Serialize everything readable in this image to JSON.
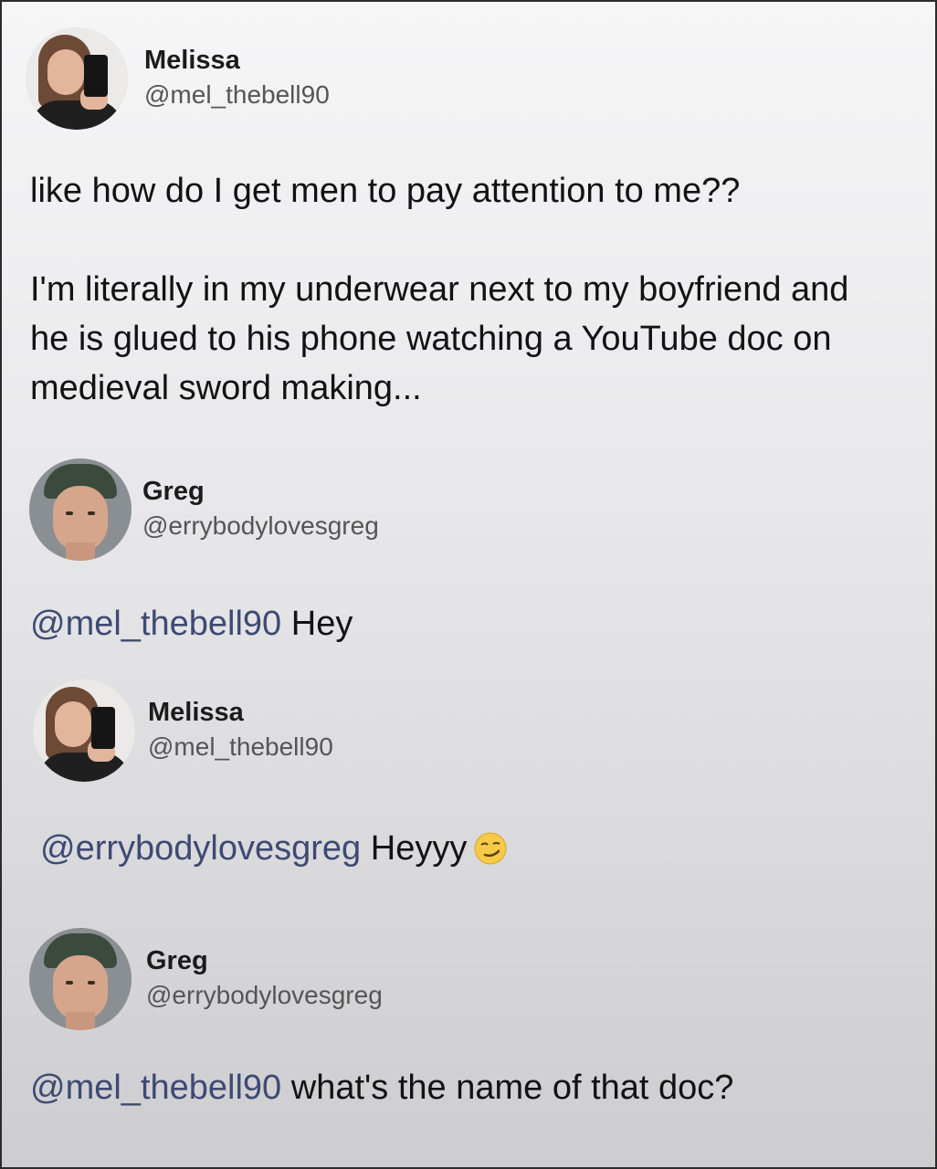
{
  "posts": [
    {
      "display_name": "Melissa",
      "handle": "@mel_thebell90",
      "avatar": "melissa-avatar",
      "text_paragraphs": [
        "like how do I get men to pay attention to me??",
        "I'm literally in my underwear next to my boyfriend and he is glued to his phone watching a YouTube doc on medieval sword making..."
      ]
    },
    {
      "display_name": "Greg",
      "handle": "@errybodylovesgreg",
      "avatar": "greg-avatar",
      "mention": "@mel_thebell90",
      "text": " Hey"
    },
    {
      "display_name": "Melissa",
      "handle": "@mel_thebell90",
      "avatar": "melissa-avatar",
      "mention": "@errybodylovesgreg",
      "text": " Heyyy",
      "emoji": "smirking-face-icon"
    },
    {
      "display_name": "Greg",
      "handle": "@errybodylovesgreg",
      "avatar": "greg-avatar",
      "mention": "@mel_thebell90",
      "text": " what's the name of that doc?"
    }
  ],
  "colors": {
    "mention": "#3e4a73",
    "text": "#121212",
    "handle": "#555555"
  }
}
